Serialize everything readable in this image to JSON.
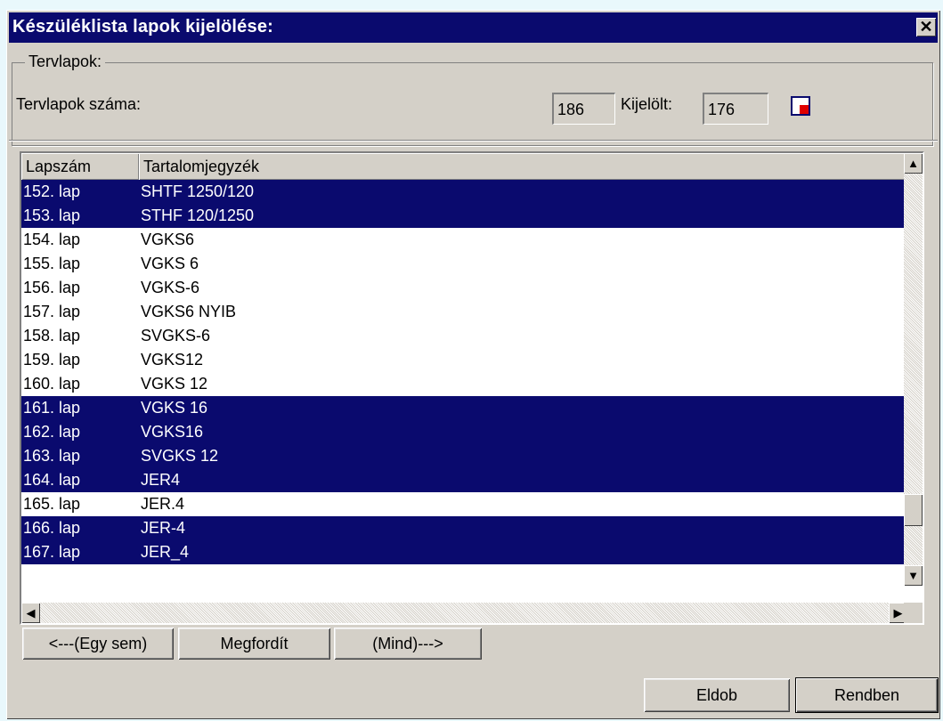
{
  "dialog": {
    "title": "Készüléklista lapok kijelölése:",
    "close_glyph": "✕"
  },
  "group": {
    "legend": "Tervlapok:",
    "count_label": "Tervlapok száma:",
    "count_value": "186",
    "selected_label": "Kijelölt:",
    "selected_value": "176"
  },
  "list": {
    "columns": [
      "Lapszám",
      "Tartalomjegyzék"
    ],
    "rows": [
      {
        "number": "152. lap",
        "content": "SHTF 1250/120",
        "selected": true
      },
      {
        "number": "153. lap",
        "content": "STHF 120/1250",
        "selected": true
      },
      {
        "number": "154. lap",
        "content": "VGKS6",
        "selected": false
      },
      {
        "number": "155. lap",
        "content": "VGKS 6",
        "selected": false
      },
      {
        "number": "156. lap",
        "content": "VGKS-6",
        "selected": false
      },
      {
        "number": "157. lap",
        "content": "VGKS6 NYIB",
        "selected": false
      },
      {
        "number": "158. lap",
        "content": "SVGKS-6",
        "selected": false
      },
      {
        "number": "159. lap",
        "content": "VGKS12",
        "selected": false
      },
      {
        "number": "160. lap",
        "content": "VGKS 12",
        "selected": false
      },
      {
        "number": "161. lap",
        "content": "VGKS 16",
        "selected": true
      },
      {
        "number": "162. lap",
        "content": "VGKS16",
        "selected": true
      },
      {
        "number": "163. lap",
        "content": "SVGKS 12",
        "selected": true
      },
      {
        "number": "164. lap",
        "content": "JER4",
        "selected": true
      },
      {
        "number": "165. lap",
        "content": "JER.4",
        "selected": false
      },
      {
        "number": "166. lap",
        "content": "JER-4",
        "selected": true
      },
      {
        "number": "167. lap",
        "content": "JER_4",
        "selected": true
      }
    ]
  },
  "buttons": {
    "none": "<---(Egy sem)",
    "invert": "Megfordít",
    "all": "(Mind)--->",
    "discard": "Eldob",
    "ok": "Rendben"
  },
  "icons": {
    "scroll_up": "▲",
    "scroll_down": "▼",
    "scroll_left": "◀",
    "scroll_right": "▶",
    "flag": "selection-status-icon"
  },
  "colors": {
    "selection": "#0a0a6e",
    "titlebar": "#0a0a6e",
    "dialog_bg": "#d4d0c8",
    "flag_red": "#e00000"
  }
}
